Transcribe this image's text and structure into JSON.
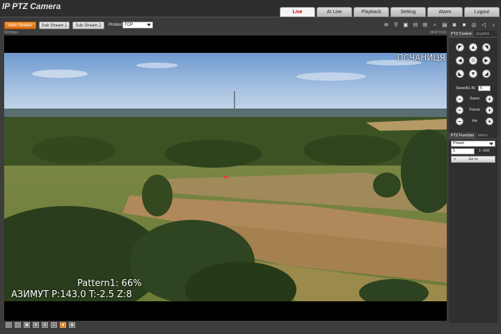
{
  "app": {
    "title": "IP PTZ Camera"
  },
  "nav": {
    "tabs": [
      "Live",
      "AI Live",
      "Playback",
      "Setting",
      "Alarm",
      "Logout"
    ],
    "active": "Live"
  },
  "toolbar": {
    "streams": [
      "Main Stream",
      "Sub Stream 1",
      "Sub Stream 2"
    ],
    "active_stream": "Main Stream",
    "protocol_label": "Protocol",
    "protocol_value": "TCP",
    "icons": [
      "wifi-icon",
      "pin-icon",
      "camera-icon",
      "rule-icon",
      "snapshot-icon",
      "zoom-icon",
      "stream-icon",
      "photo-icon",
      "record-icon",
      "fisheye-icon",
      "volume-icon",
      "mic-icon"
    ]
  },
  "video": {
    "bitrate": "601Kbps",
    "resolution": "3840*2160",
    "osd_top_right": "ПСЧАНИЦЯ",
    "osd_pattern": "Pattern1: 66%",
    "osd_azimuth": "АЗИМУТ  P:143.0 T:-2.5 Z:8"
  },
  "bottom_icons": [
    "fit-icon",
    "original-icon",
    "full-icon",
    "window-icon",
    "digital-zoom-icon",
    "face-icon",
    "ai-icon",
    "focus-icon"
  ],
  "ptz": {
    "tabs": [
      "PTZ Control",
      "Joystick"
    ],
    "active_tab": "PTZ Control",
    "speed_label": "Speed(1-8):",
    "speed_value": "5",
    "zoom_label": "Zoom",
    "focus_label": "Focus",
    "iris_label": "Iris",
    "minus_label": "−",
    "plus_label": "+"
  },
  "ptz_function": {
    "tabs": [
      "PTZ Function",
      "Menu"
    ],
    "active_tab": "PTZ Function",
    "mode": "Preset",
    "preset_value": "1",
    "preset_range": "1~300",
    "goto_label": "Go to"
  },
  "colors": {
    "accent": "#e07a1a",
    "active_tab_text": "#cc0000"
  }
}
